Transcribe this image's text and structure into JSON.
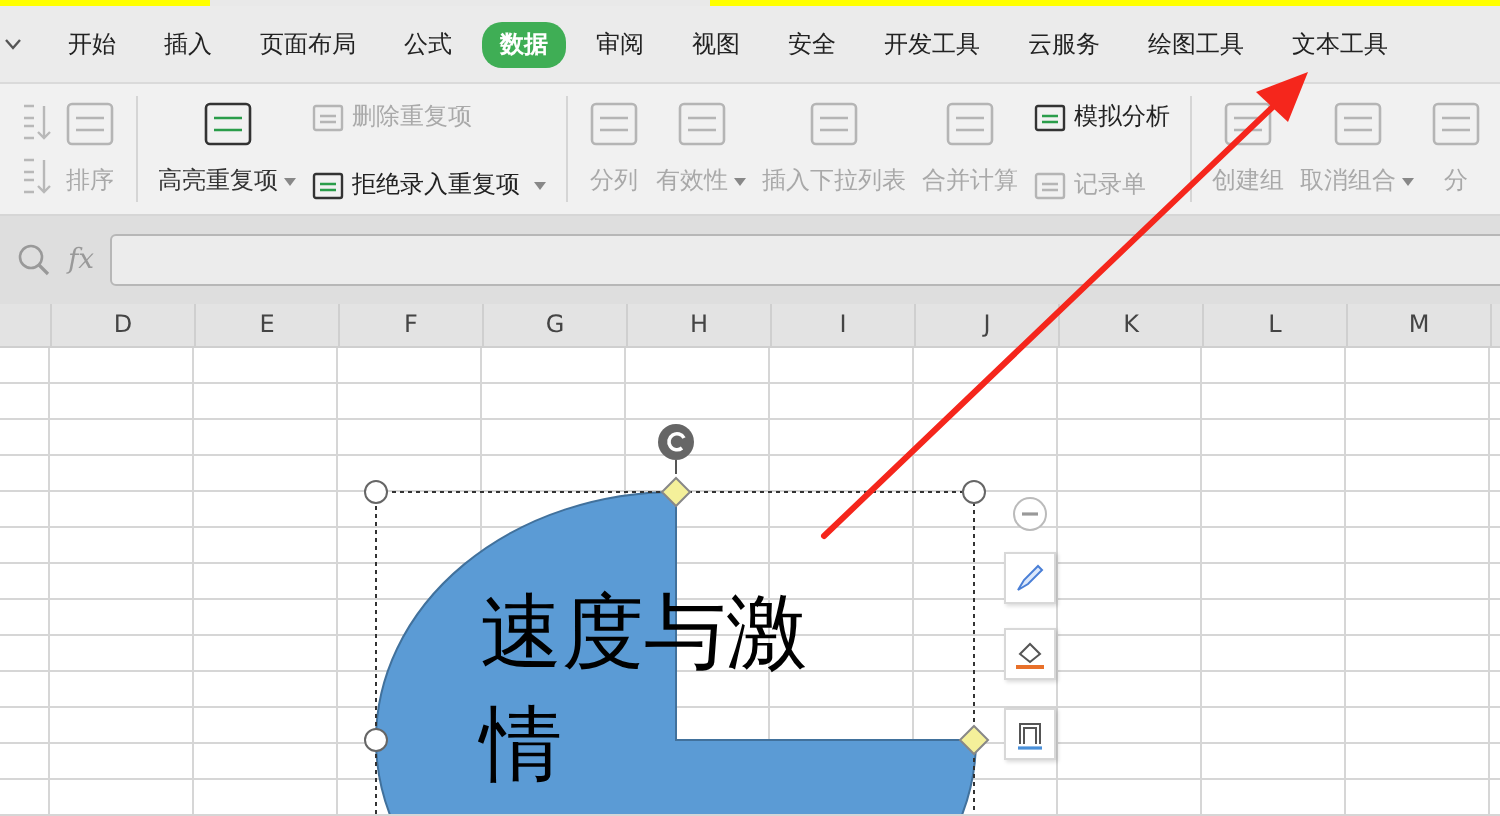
{
  "tabs": [
    {
      "label": "开始",
      "selected": false
    },
    {
      "label": "插入",
      "selected": false
    },
    {
      "label": "页面布局",
      "selected": false
    },
    {
      "label": "公式",
      "selected": false
    },
    {
      "label": "数据",
      "selected": true
    },
    {
      "label": "审阅",
      "selected": false
    },
    {
      "label": "视图",
      "selected": false
    },
    {
      "label": "安全",
      "selected": false
    },
    {
      "label": "开发工具",
      "selected": false
    },
    {
      "label": "云服务",
      "selected": false
    },
    {
      "label": "绘图工具",
      "selected": false
    },
    {
      "label": "文本工具",
      "selected": false
    }
  ],
  "ribbon": [
    {
      "kind": "sort_pair",
      "disabled": true
    },
    {
      "kind": "large",
      "label": "排序",
      "disabled": true,
      "dropdown": false
    },
    {
      "kind": "separator"
    },
    {
      "kind": "large",
      "label": "高亮重复项",
      "disabled": false,
      "dropdown": true
    },
    {
      "kind": "stack",
      "items": [
        {
          "label": "删除重复项",
          "disabled": true,
          "dropdown": false
        },
        {
          "label": "拒绝录入重复项",
          "disabled": false,
          "dropdown": true
        }
      ]
    },
    {
      "kind": "separator"
    },
    {
      "kind": "large",
      "label": "分列",
      "disabled": true,
      "dropdown": false
    },
    {
      "kind": "large",
      "label": "有效性",
      "disabled": true,
      "dropdown": true
    },
    {
      "kind": "large",
      "label": "插入下拉列表",
      "disabled": true,
      "dropdown": false
    },
    {
      "kind": "large",
      "label": "合并计算",
      "disabled": true,
      "dropdown": false
    },
    {
      "kind": "stack",
      "items": [
        {
          "label": "模拟分析",
          "disabled": false,
          "dropdown": false
        },
        {
          "label": "记录单",
          "disabled": true,
          "dropdown": false
        }
      ]
    },
    {
      "kind": "separator"
    },
    {
      "kind": "large",
      "label": "创建组",
      "disabled": true,
      "dropdown": false
    },
    {
      "kind": "large",
      "label": "取消组合",
      "disabled": true,
      "dropdown": true
    },
    {
      "kind": "large",
      "label": "分",
      "disabled": true,
      "dropdown": false
    }
  ],
  "formula_bar": {
    "function_label": "fx"
  },
  "columns": [
    "D",
    "E",
    "F",
    "G",
    "H",
    "I",
    "J",
    "K",
    "L",
    "M"
  ],
  "shape": {
    "text": "速度与激情",
    "selected": true
  }
}
